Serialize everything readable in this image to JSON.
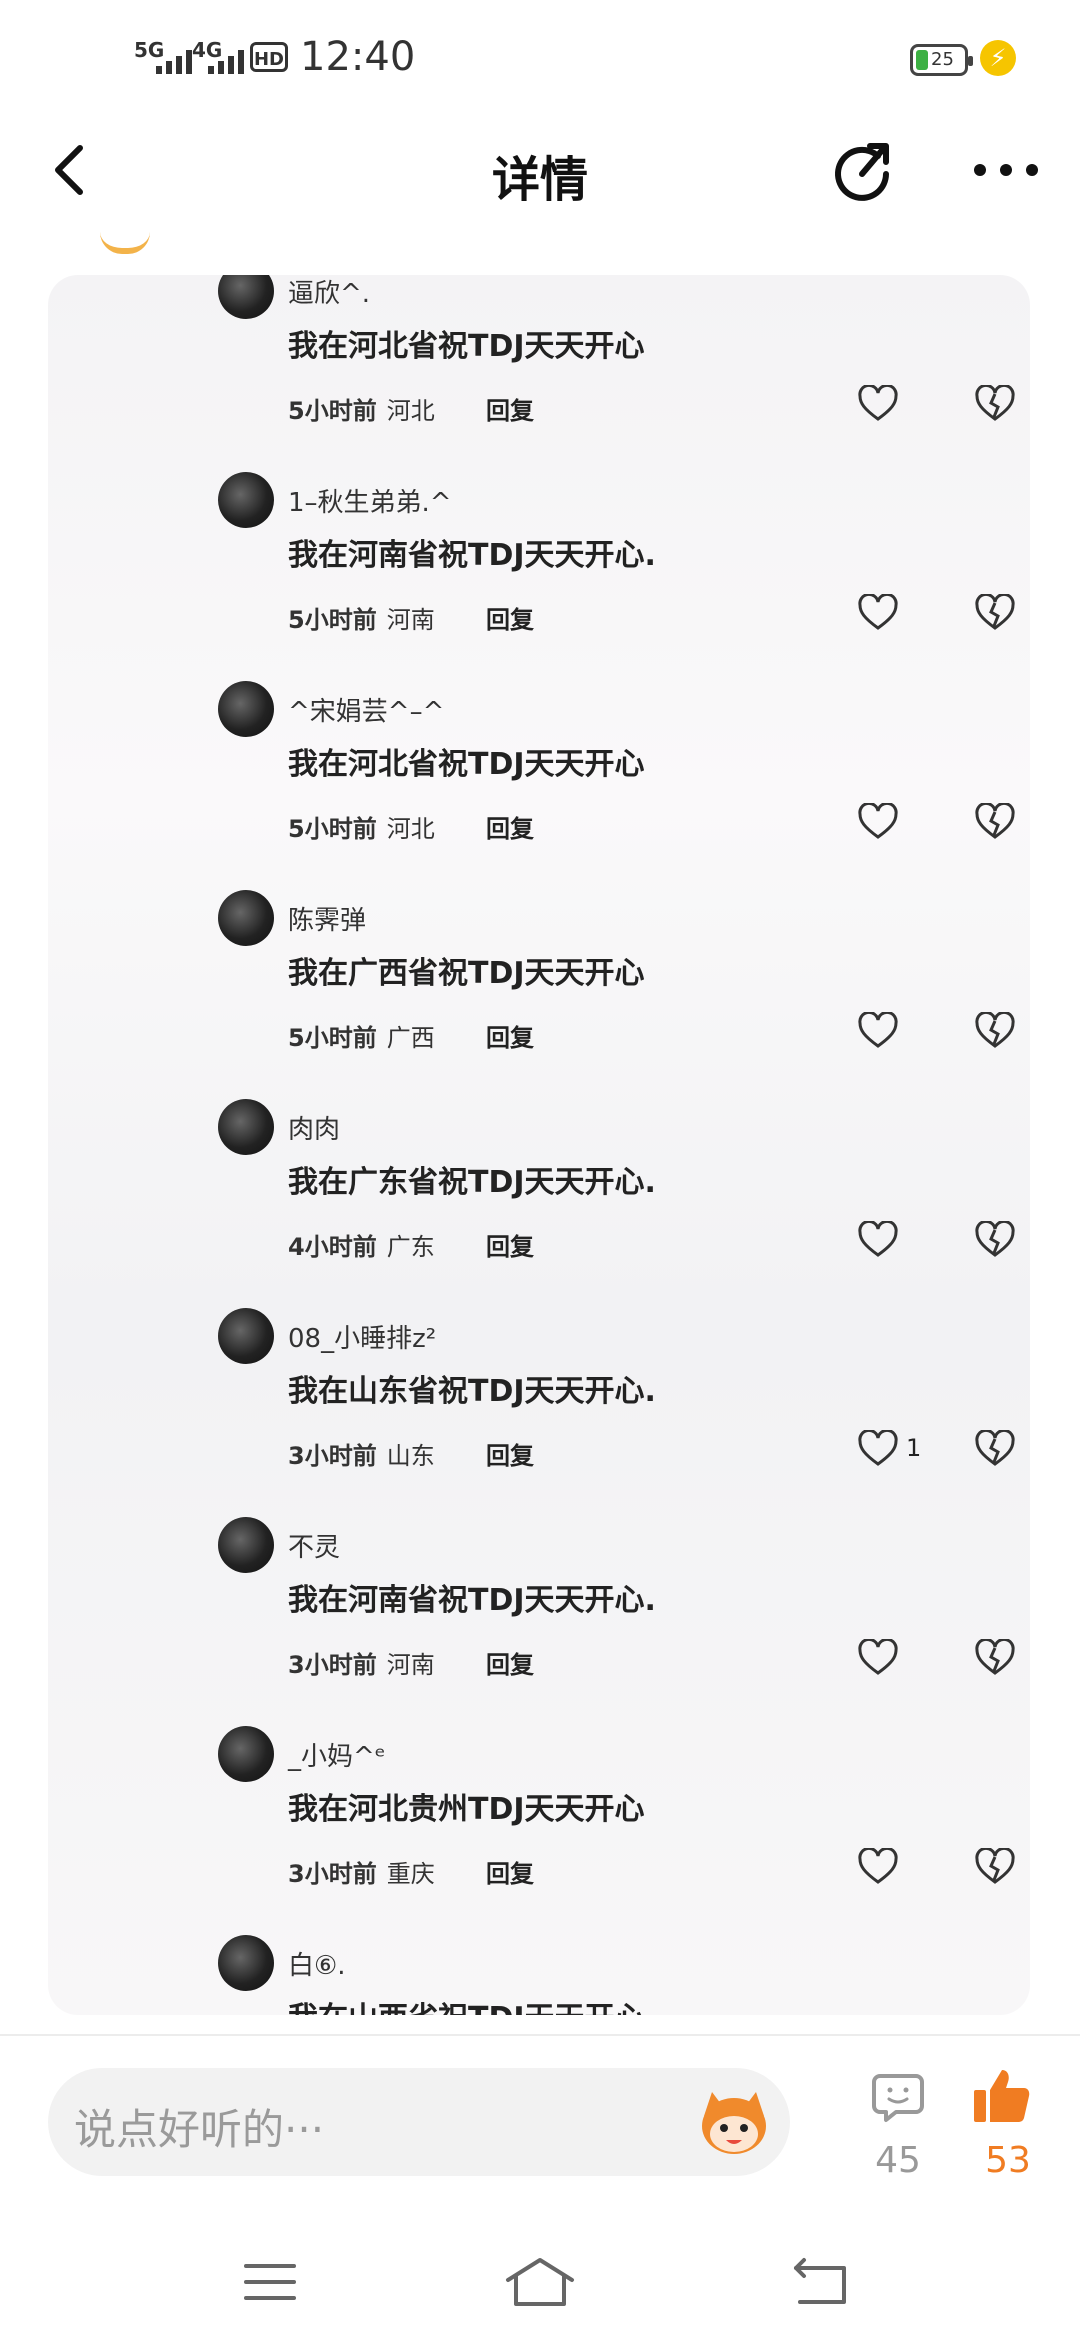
{
  "status_bar": {
    "net1": "5G",
    "net2": "4G",
    "hd": "HD",
    "time": "12:40",
    "battery": "25"
  },
  "header": {
    "title": "详情"
  },
  "comments": [
    {
      "name": "逼欣^.",
      "text": "我在河北省祝TDJ天天开心",
      "time": "5小时前",
      "location": "河北",
      "reply": "回复",
      "likes": ""
    },
    {
      "name": "1–秋生弟弟.^",
      "text": "我在河南省祝TDJ天天开心.",
      "time": "5小时前",
      "location": "河南",
      "reply": "回复",
      "likes": ""
    },
    {
      "name": "^宋娟芸^–^",
      "text": "我在河北省祝TDJ天天开心",
      "time": "5小时前",
      "location": "河北",
      "reply": "回复",
      "likes": ""
    },
    {
      "name": "陈霁弹",
      "text": "我在广西省祝TDJ天天开心",
      "time": "5小时前",
      "location": "广西",
      "reply": "回复",
      "likes": ""
    },
    {
      "name": "肉肉",
      "text": "我在广东省祝TDJ天天开心.",
      "time": "4小时前",
      "location": "广东",
      "reply": "回复",
      "likes": ""
    },
    {
      "name": "08_小睡排z²",
      "text": "我在山东省祝TDJ天天开心.",
      "time": "3小时前",
      "location": "山东",
      "reply": "回复",
      "likes": "1"
    },
    {
      "name": "不灵",
      "text": "我在河南省祝TDJ天天开心.",
      "time": "3小时前",
      "location": "河南",
      "reply": "回复",
      "likes": ""
    },
    {
      "name": "_小妈^ᵉ",
      "text": "我在河北贵州TDJ天天开心",
      "time": "3小时前",
      "location": "重庆",
      "reply": "回复",
      "likes": ""
    },
    {
      "name": "白⑥.",
      "text": "我在山西省祝TDJ天天开心",
      "time": "",
      "location": "",
      "reply": "",
      "likes": ""
    }
  ],
  "bottom_bar": {
    "input_placeholder": "说点好听的···",
    "comment_count": "45",
    "like_count": "53"
  },
  "colors": {
    "accent": "#f07c22",
    "battery_green": "#3cb043",
    "charging_yellow": "#f6c500"
  },
  "icons": {
    "back": "chevron-left-icon",
    "share": "share-icon",
    "more": "more-dots-icon",
    "comment": "comment-bubble-icon",
    "like": "thumbs-up-icon",
    "heart": "heart-icon",
    "broken_heart": "broken-heart-icon"
  }
}
